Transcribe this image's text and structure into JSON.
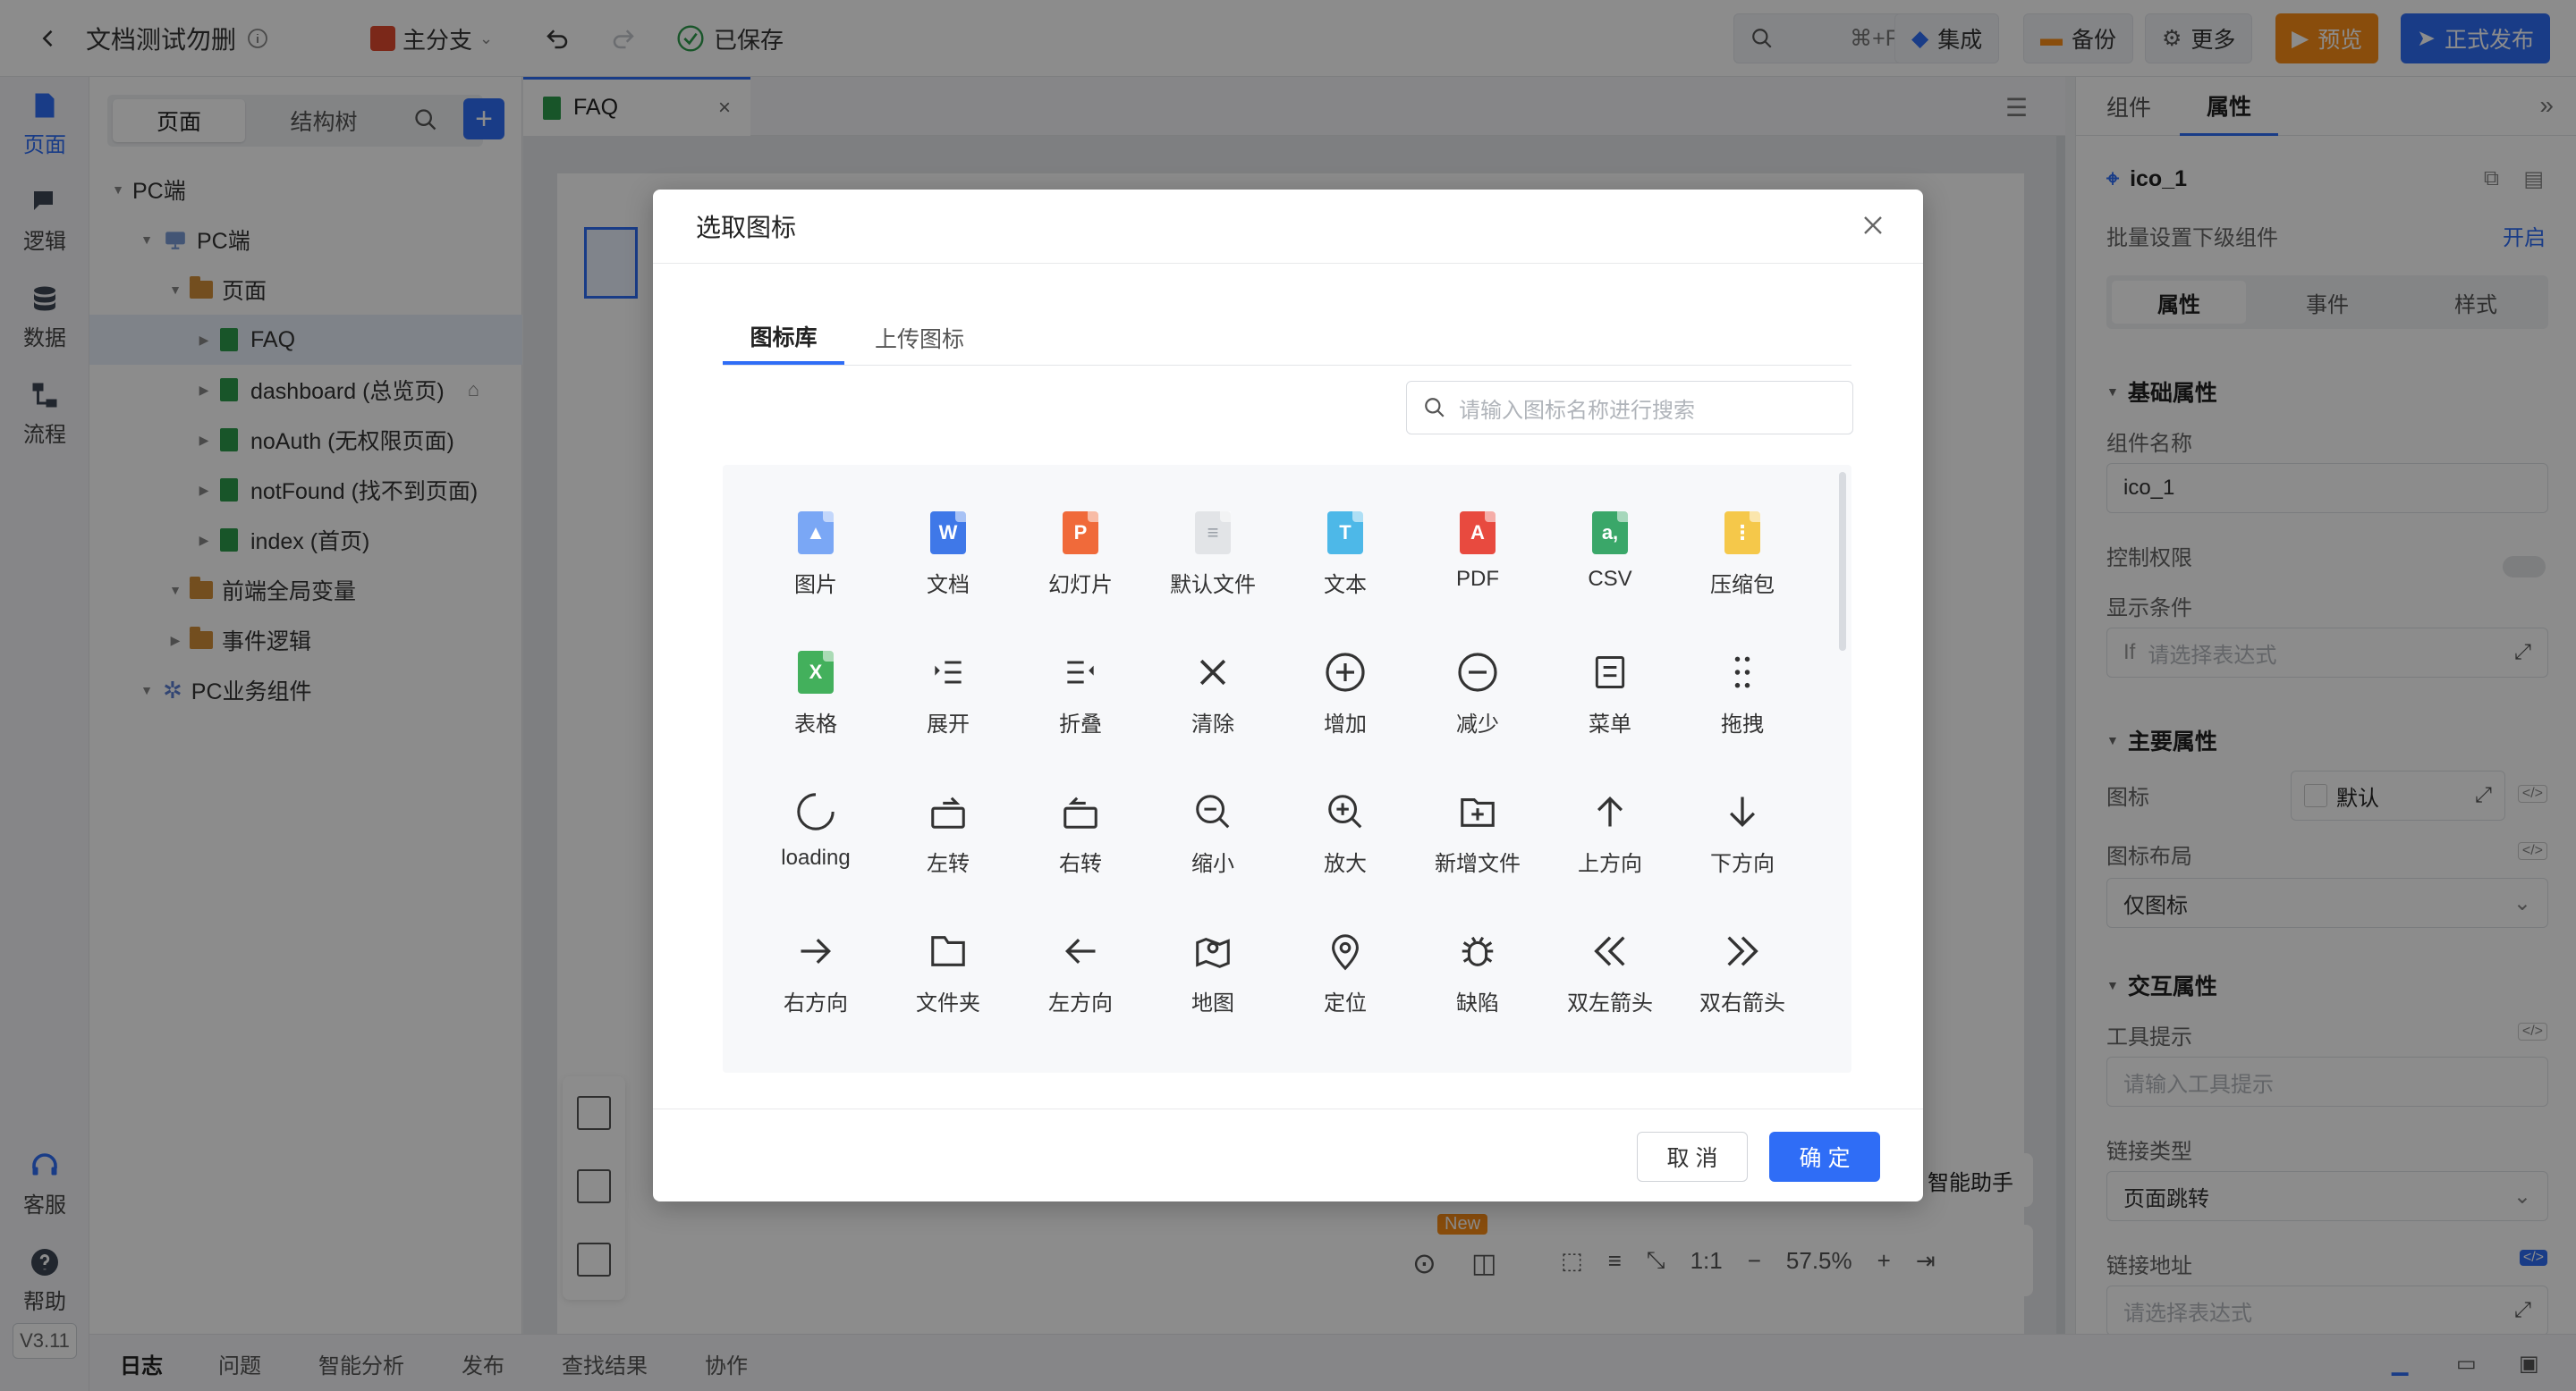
{
  "app": {
    "title": "文档测试勿删",
    "branch": "主分支",
    "save_status": "已保存",
    "search_shortcut": "⌘+F",
    "btn_integrate": "集成",
    "btn_backup": "备份",
    "btn_more": "更多",
    "btn_preview": "预览",
    "btn_publish": "正式发布"
  },
  "rail": {
    "items": [
      {
        "label": "页面",
        "icon": "page-icon"
      },
      {
        "label": "逻辑",
        "icon": "logic-icon"
      },
      {
        "label": "数据",
        "icon": "database-icon"
      },
      {
        "label": "流程",
        "icon": "flow-icon"
      }
    ],
    "service": "客服",
    "help": "帮助",
    "version": "V3.11"
  },
  "tree": {
    "tabs": [
      "页面",
      "结构树"
    ],
    "rows": [
      {
        "label": "PC端"
      },
      {
        "label": "PC端"
      },
      {
        "label": "页面"
      },
      {
        "label": "FAQ"
      },
      {
        "label": "dashboard (总览页)"
      },
      {
        "label": "noAuth (无权限页面)"
      },
      {
        "label": "notFound (找不到页面)"
      },
      {
        "label": "index (首页)"
      },
      {
        "label": "前端全局变量"
      },
      {
        "label": "事件逻辑"
      },
      {
        "label": "PC业务组件"
      }
    ]
  },
  "editor": {
    "tab": "FAQ",
    "assistant": "智能助手",
    "new_badge": "New",
    "zoom": "57.5%",
    "ratio": "1:1"
  },
  "props": {
    "tabs": [
      "组件",
      "属性"
    ],
    "component_name": "ico_1",
    "batch_label": "批量设置下级组件",
    "batch_action": "开启",
    "sub_tabs": [
      "属性",
      "事件",
      "样式"
    ],
    "basic_section": "基础属性",
    "name_label": "组件名称",
    "name_value": "ico_1",
    "perm_label": "控制权限",
    "cond_label": "显示条件",
    "cond_prefix": "If",
    "cond_placeholder": "请选择表达式",
    "main_section": "主要属性",
    "icon_label": "图标",
    "icon_value": "默认",
    "layout_label": "图标布局",
    "layout_value": "仅图标",
    "interact_section": "交互属性",
    "tooltip_label": "工具提示",
    "tooltip_placeholder": "请输入工具提示",
    "link_type_label": "链接类型",
    "link_type_value": "页面跳转",
    "link_addr_label": "链接地址",
    "link_addr_placeholder": "请选择表达式"
  },
  "bottom": {
    "items": [
      "日志",
      "问题",
      "智能分析",
      "发布",
      "查找结果",
      "协作"
    ]
  },
  "modal": {
    "title": "选取图标",
    "tabs": [
      "图标库",
      "上传图标"
    ],
    "search_placeholder": "请输入图标名称进行搜索",
    "cancel": "取 消",
    "ok": "确 定",
    "icons": [
      {
        "label": "图片",
        "icon": "image-file-icon",
        "color": "#7aa7f5"
      },
      {
        "label": "文档",
        "icon": "word-file-icon",
        "color": "#3f78e8"
      },
      {
        "label": "幻灯片",
        "icon": "ppt-file-icon",
        "color": "#f06a3a"
      },
      {
        "label": "默认文件",
        "icon": "default-file-icon",
        "color": "#d9dbde"
      },
      {
        "label": "文本",
        "icon": "text-file-icon",
        "color": "#4db8e8"
      },
      {
        "label": "PDF",
        "icon": "pdf-file-icon",
        "color": "#e84a3f"
      },
      {
        "label": "CSV",
        "icon": "csv-file-icon",
        "color": "#3aa769"
      },
      {
        "label": "压缩包",
        "icon": "zip-file-icon",
        "color": "#f5c84a"
      },
      {
        "label": "表格",
        "icon": "excel-file-icon",
        "color": "#43b05c"
      },
      {
        "label": "展开",
        "icon": "expand-icon"
      },
      {
        "label": "折叠",
        "icon": "collapse-icon"
      },
      {
        "label": "清除",
        "icon": "clear-icon"
      },
      {
        "label": "增加",
        "icon": "add-circle-icon"
      },
      {
        "label": "减少",
        "icon": "minus-circle-icon"
      },
      {
        "label": "菜单",
        "icon": "menu-icon"
      },
      {
        "label": "拖拽",
        "icon": "drag-icon"
      },
      {
        "label": "loading",
        "icon": "loading-icon"
      },
      {
        "label": "左转",
        "icon": "rotate-left-icon"
      },
      {
        "label": "右转",
        "icon": "rotate-right-icon"
      },
      {
        "label": "缩小",
        "icon": "zoom-out-icon"
      },
      {
        "label": "放大",
        "icon": "zoom-in-icon"
      },
      {
        "label": "新增文件",
        "icon": "new-folder-icon"
      },
      {
        "label": "上方向",
        "icon": "arrow-up-icon"
      },
      {
        "label": "下方向",
        "icon": "arrow-down-icon"
      },
      {
        "label": "右方向",
        "icon": "arrow-right-icon"
      },
      {
        "label": "文件夹",
        "icon": "folder-icon"
      },
      {
        "label": "左方向",
        "icon": "arrow-left-icon"
      },
      {
        "label": "地图",
        "icon": "map-icon"
      },
      {
        "label": "定位",
        "icon": "location-icon"
      },
      {
        "label": "缺陷",
        "icon": "bug-icon"
      },
      {
        "label": "双左箭头",
        "icon": "double-left-icon"
      },
      {
        "label": "双右箭头",
        "icon": "double-right-icon"
      }
    ]
  }
}
